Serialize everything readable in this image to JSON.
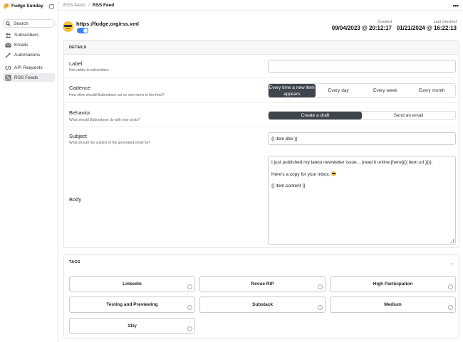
{
  "app": {
    "name": "Fudge Sunday"
  },
  "sidebar": {
    "search_label": "Search",
    "items": [
      {
        "label": "Subscribers",
        "icon": "users-icon"
      },
      {
        "label": "Emails",
        "icon": "envelope-icon"
      },
      {
        "label": "Automations",
        "icon": "wand-icon"
      },
      {
        "label": "API Requests",
        "icon": "code-icon"
      },
      {
        "label": "RSS Feeds",
        "icon": "rss-icon",
        "active": true
      }
    ]
  },
  "breadcrumb": {
    "parent": "RSS feeds",
    "separator": "/",
    "current": "RSS Feed"
  },
  "header": {
    "url": "https://fudge.org/rss.xml",
    "enabled": true,
    "created_label": "Created",
    "created_value": "09/04/2023 @ 20:12:17",
    "checked_label": "Last checked",
    "checked_value": "01/21/2024 @ 16:22:13"
  },
  "details": {
    "heading": "DETAILS",
    "label": {
      "title": "Label",
      "desc": "Not visible to subscribers.",
      "value": ""
    },
    "cadence": {
      "title": "Cadence",
      "desc": "How often should Buttondown act on new items in this feed?",
      "options": [
        "Every time a new item appears",
        "Every day",
        "Every week",
        "Every month"
      ],
      "selected": 0
    },
    "behavior": {
      "title": "Behavior",
      "desc": "What should Buttondown do with new posts?",
      "options": [
        "Create a draft",
        "Send an email"
      ],
      "selected": 0
    },
    "subject": {
      "title": "Subject",
      "desc": "What should the subject of the generated email be?",
      "value": "{{ item.title }}"
    },
    "body": {
      "title": "Body",
      "line1": "I just published my latest newsletter issue... (read it online [here]({{ item.url }})):",
      "line2": "Here's a copy for your inbox.",
      "line3": "{{ item.content }}"
    }
  },
  "tags": {
    "heading": "TAGS",
    "items": [
      "Linkedin",
      "Revue RIP",
      "High Participation",
      "Testing and Previewing",
      "Substack",
      "Medium",
      "11ty"
    ]
  },
  "colors": {
    "accent": "#3b82f6",
    "selected_segment": "#3f454d"
  }
}
